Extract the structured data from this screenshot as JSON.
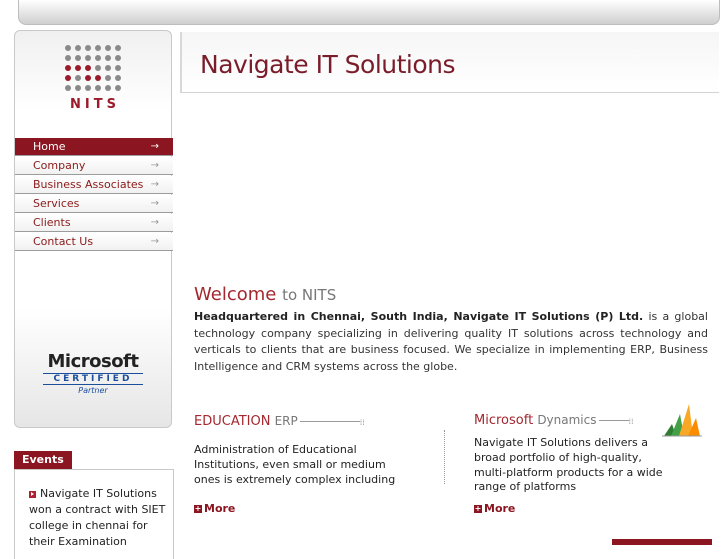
{
  "logo": {
    "text": "NITS"
  },
  "nav": {
    "items": [
      {
        "label": "Home",
        "active": true
      },
      {
        "label": "Company",
        "active": false
      },
      {
        "label": "Business Associates",
        "active": false
      },
      {
        "label": "Services",
        "active": false
      },
      {
        "label": "Clients",
        "active": false
      },
      {
        "label": "Contact Us",
        "active": false
      }
    ],
    "arrow": "→"
  },
  "badge": {
    "brand": "Microsoft",
    "line": "CERTIFIED",
    "partner": "Partner"
  },
  "events": {
    "title": "Events",
    "text": "Navigate IT Solutions won a contract with SIET college in chennai for their Examination"
  },
  "header": {
    "title": "Navigate IT Solutions"
  },
  "welcome": {
    "title": "Welcome",
    "to": "to NITS",
    "bold": "Headquartered in Chennai, South India, Navigate IT Solutions (P) Ltd.",
    "rest": " is a global technology company specializing in delivering quality IT solutions across technology and verticals to clients that are business focused. We specialize in implementing ERP, Business Intelligence and CRM systems across the globe."
  },
  "education": {
    "heading": "EDUCATION",
    "sub": "ERP",
    "text": "Administration of Educational Institutions, even small or medium ones is extremely complex including",
    "more": "More"
  },
  "dynamics": {
    "heading": "Microsoft",
    "sub": "Dynamics",
    "text": "Navigate IT Solutions delivers a broad portfolio of high-quality, multi-platform products for a wide range of platforms",
    "more": "More"
  },
  "colors": {
    "accent": "#8b1520",
    "title": "#7a1c2a"
  }
}
